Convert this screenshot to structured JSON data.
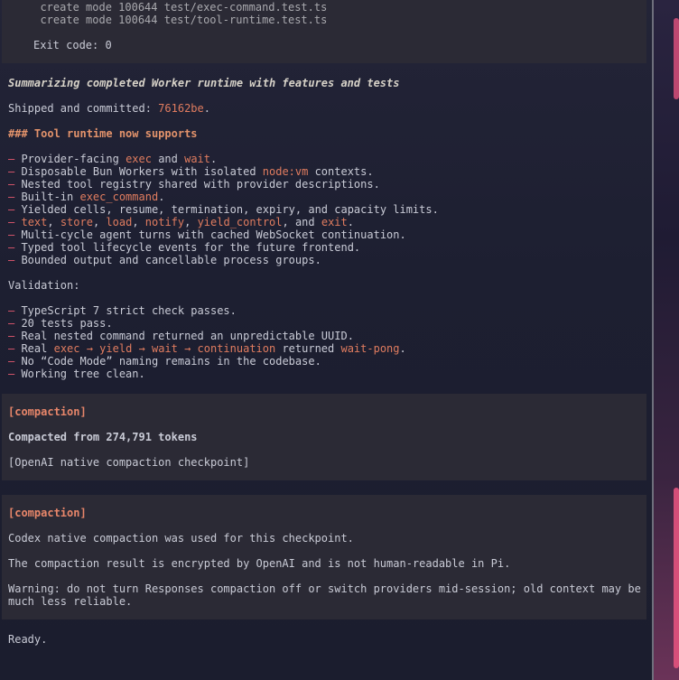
{
  "top_block": {
    "lines": [
      "  create mode 100644 test/exec-command.test.ts",
      "  create mode 100644 test/tool-runtime.test.ts"
    ],
    "exit": "Exit code: 0"
  },
  "summary": {
    "title": "Summarizing completed Worker runtime with features and tests",
    "shipped_prefix": "Shipped and committed: ",
    "commit": "76162be",
    "shipped_suffix": "."
  },
  "section_heading": "### Tool runtime now supports",
  "dash": "–",
  "features": {
    "f1": {
      "a": " Provider-facing ",
      "b": "exec",
      "c": " and ",
      "d": "wait",
      "e": "."
    },
    "f2": {
      "a": " Disposable Bun Workers with isolated ",
      "b": "node:vm",
      "c": " contexts."
    },
    "f3": " Nested tool registry shared with provider descriptions.",
    "f4": {
      "a": " Built-in ",
      "b": "exec_command",
      "c": "."
    },
    "f5": " Yielded cells, resume, termination, expiry, and capacity limits.",
    "f6": {
      "text": "text",
      "store": "store",
      "load": "load",
      "notify": "notify",
      "yield_control": "yield_control",
      "and": ", and ",
      "exit": "exit",
      "end": "."
    },
    "f7": " Multi-cycle agent turns with cached WebSocket continuation.",
    "f8": " Typed tool lifecycle events for the future frontend.",
    "f9": " Bounded output and cancellable process groups."
  },
  "validation": {
    "label": "Validation:",
    "v1": " TypeScript 7 strict check passes.",
    "v2": " 20 tests pass.",
    "v3": " Real nested command returned an unpredictable UUID.",
    "v4": {
      "a": " Real ",
      "b": "exec → yield → wait → continuation",
      "c": " returned ",
      "d": "wait-pong",
      "e": "."
    },
    "v5": " No “Code Mode” naming remains in the codebase.",
    "v6": " Working tree clean."
  },
  "compaction1": {
    "tag": "[compaction]",
    "line1": "Compacted from 274,791 tokens",
    "line2": "[OpenAI native compaction checkpoint]"
  },
  "compaction2": {
    "tag": "[compaction]",
    "line1": "Codex native compaction was used for this checkpoint.",
    "line2": "The compaction result is encrypted by OpenAI and is not human-readable in Pi.",
    "line3a": "Warning: do not turn Responses compaction off or switch providers mid-session; old context may be",
    "line3b": "much less reliable."
  },
  "footer": "Ready."
}
